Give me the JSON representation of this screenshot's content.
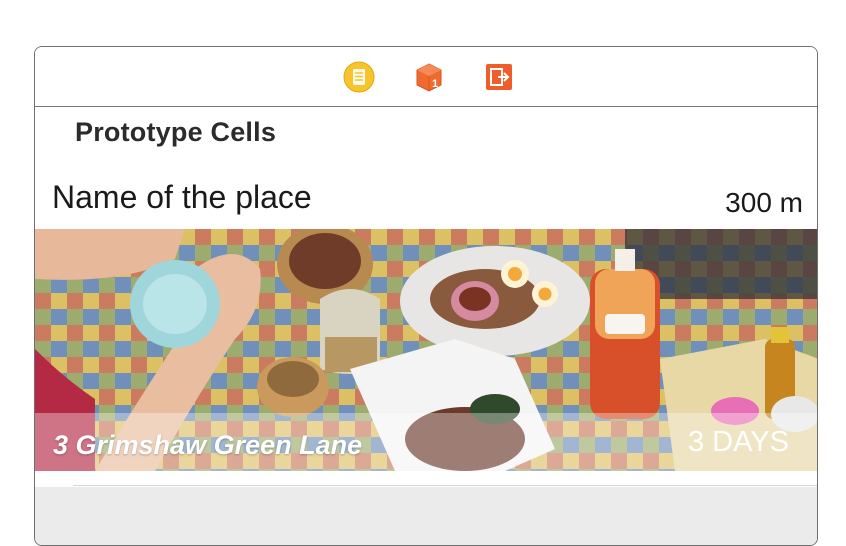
{
  "dock": {
    "icons": [
      "view-controller-icon",
      "first-responder-icon",
      "exit-icon"
    ],
    "colors": {
      "controller": "#f7c52b",
      "responder": "#ef6a2f",
      "exit": "#ef5d2a"
    }
  },
  "table": {
    "section_title": "Prototype Cells"
  },
  "cell": {
    "place_name": "Name of the place",
    "distance": "300 m",
    "photo_label": "food-photo",
    "address": "3 Grimshaw Green Lane",
    "duration": "3 DAYS"
  }
}
